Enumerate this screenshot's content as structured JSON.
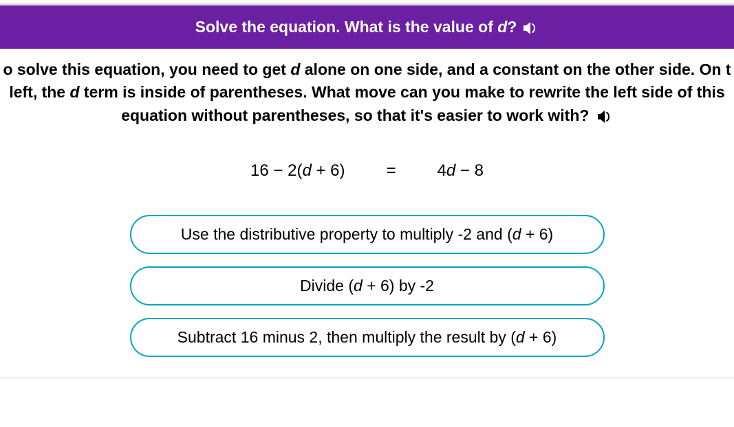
{
  "header": {
    "question_prefix": "Solve the equation. What is the value of ",
    "variable": "d",
    "question_suffix": "?"
  },
  "prompt": {
    "line1_a": "o solve this equation, you need to get ",
    "line1_var": "d",
    "line1_b": " alone on one side, and a constant on the other side. On t",
    "line2_a": " left, the ",
    "line2_var": "d",
    "line2_b": " term is inside of parentheses. What move can you make to rewrite the left side of this",
    "line3": "equation without parentheses, so that it's easier to work with?"
  },
  "equation": {
    "left_a": "16 − 2(",
    "left_var": "d",
    "left_b": " + 6)",
    "eq": "=",
    "right_a": "4",
    "right_var": "d",
    "right_b": " − 8"
  },
  "choices": {
    "c1_a": "Use the distributive property to multiply -2 and (",
    "c1_var": "d",
    "c1_b": " + 6)",
    "c2_a": "Divide (",
    "c2_var": "d",
    "c2_b": " + 6) by -2",
    "c3_a": "Subtract 16 minus 2, then multiply the result by (",
    "c3_var": "d",
    "c3_b": " + 6)"
  }
}
